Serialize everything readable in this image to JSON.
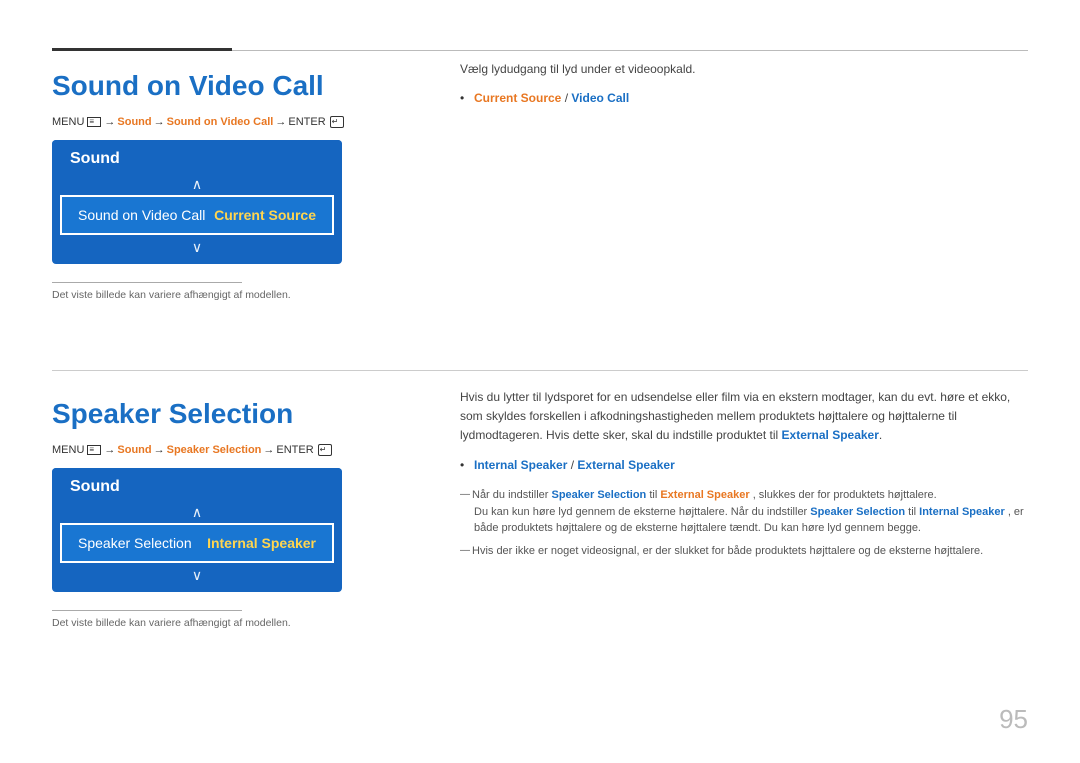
{
  "page": {
    "number": "95"
  },
  "top_rule": {
    "visible": true
  },
  "section1": {
    "title": "Sound on Video Call",
    "menu_path": {
      "prefix": "MENU",
      "items": [
        "Sound",
        "Sound on Video Call",
        "ENTER"
      ]
    },
    "panel": {
      "header": "Sound",
      "row_label": "Sound on Video Call",
      "row_value": "Current Source",
      "chevron_up": "∧",
      "chevron_down": "∨"
    },
    "caption": "Det viste billede kan variere afhængigt af modellen.",
    "right": {
      "desc": "Vælg lydudgang til lyd under et videoopkald.",
      "bullet_label1": "Current Source",
      "bullet_sep": " / ",
      "bullet_label2": "Video Call"
    }
  },
  "section2": {
    "title": "Speaker Selection",
    "menu_path": {
      "prefix": "MENU",
      "items": [
        "Sound",
        "Speaker Selection",
        "ENTER"
      ]
    },
    "panel": {
      "header": "Sound",
      "row_label": "Speaker Selection",
      "row_value": "Internal Speaker",
      "chevron_up": "∧",
      "chevron_down": "∨"
    },
    "caption": "Det viste billede kan variere afhængigt af modellen.",
    "right": {
      "desc": "Hvis du lytter til lydsporet for en udsendelse eller film via en ekstern modtager, kan du evt. høre et ekko, som skyldes forskellen i afkodningshastigheden mellem produktets højttalere og højttalerne til lydmodtageren. Hvis dette sker, skal du indstille produktet til",
      "desc_highlight": "External Speaker",
      "bullet_label1": "Internal Speaker",
      "bullet_sep": " / ",
      "bullet_label2": "External Speaker",
      "note1": "Når du indstiller",
      "note1_b1": "Speaker Selection",
      "note1_mid": "til",
      "note1_b2": "External Speaker",
      "note1_end": ", slukkes der for produktets højttalere.",
      "note2a": "Du kan kun høre lyd gennem de eksterne højttalere. Når du indstiller",
      "note2a_b": "Speaker Selection",
      "note2a_mid": "til",
      "note2a_b2": "Internal Speaker",
      "note2a_end": ", er både produktets højttalere og de eksterne højttalere tændt. Du kan høre lyd gennem begge.",
      "note3": "Hvis der ikke er noget videosignal, er der slukket for både produktets højttalere og de eksterne højttalere."
    }
  }
}
